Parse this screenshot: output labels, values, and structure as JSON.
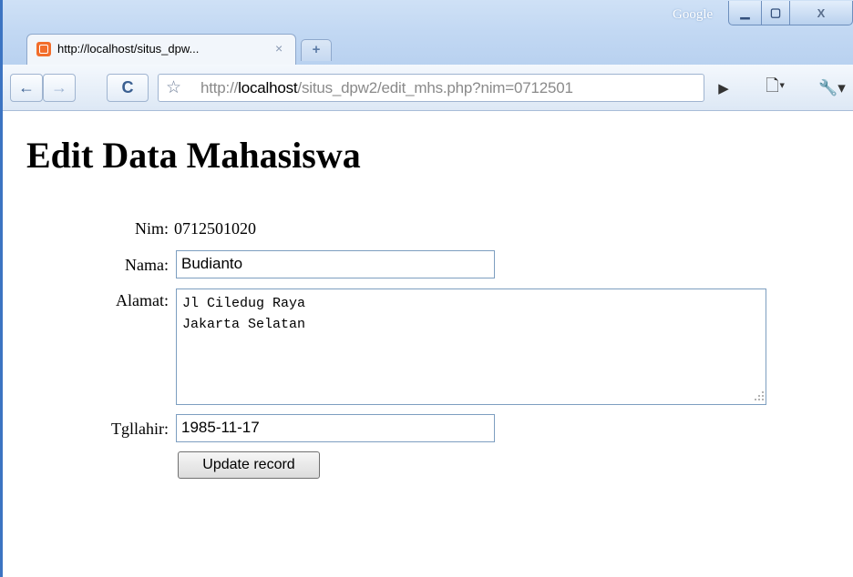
{
  "window": {
    "brand": "Google",
    "controls": {
      "minimize": "▁",
      "maximize": "▢",
      "close": "X"
    }
  },
  "tabs": [
    {
      "title": "http://localhost/situs_dpw...",
      "close": "×"
    }
  ],
  "new_tab": "+",
  "toolbar": {
    "back": "←",
    "forward": "→",
    "reload": "C",
    "star": "☆",
    "url_scheme": "http://",
    "url_host": "localhost",
    "url_path": "/situs_dpw2/edit_mhs.php?nim=0712501",
    "go": "▶",
    "page_menu": "🗋▾",
    "tools_menu": "🔧▾"
  },
  "page": {
    "heading": "Edit Data Mahasiswa",
    "form": {
      "nim_label": "Nim:",
      "nim_value": "0712501020",
      "nama_label": "Nama:",
      "nama_value": "Budianto",
      "alamat_label": "Alamat:",
      "alamat_value": "Jl Ciledug Raya\nJakarta Selatan",
      "tgllahir_label": "Tgllahir:",
      "tgllahir_value": "1985-11-17",
      "submit_label": "Update record"
    }
  }
}
